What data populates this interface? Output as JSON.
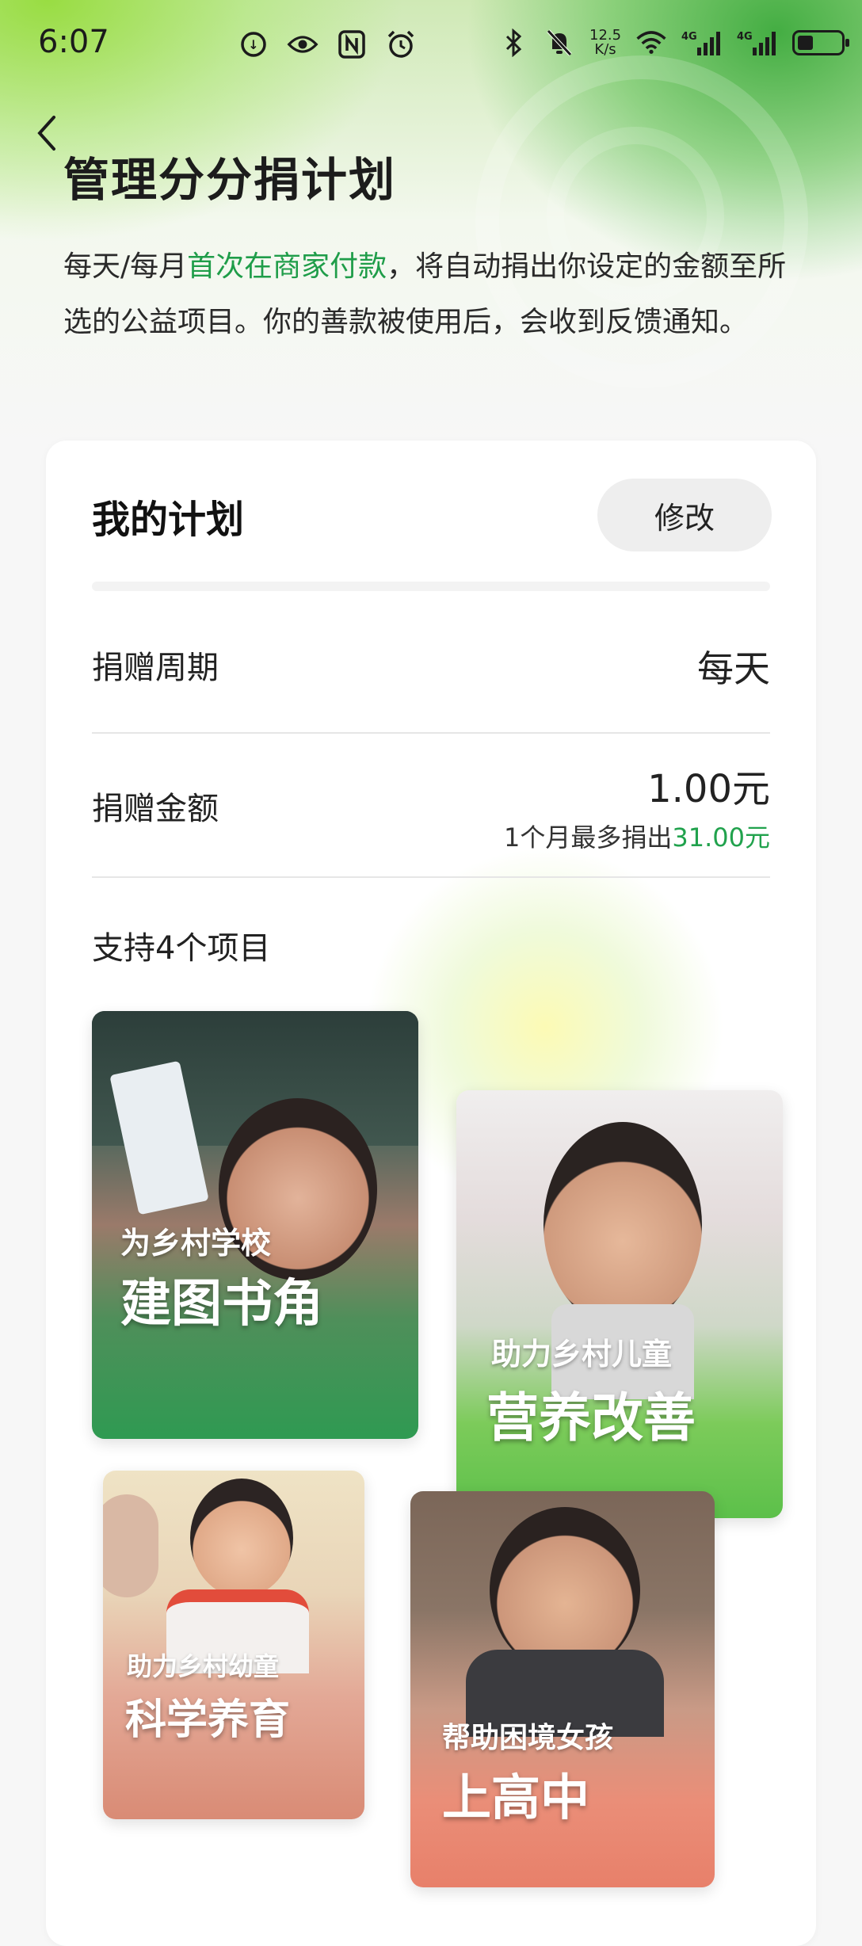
{
  "status_bar": {
    "time": "6:07",
    "net_speed_top": "12.5",
    "net_speed_bottom": "K/s",
    "battery_level": 0.35,
    "network_label_1": "4G",
    "network_label_2": "4G"
  },
  "header": {
    "title": "管理分分捐计划",
    "desc_before": "每天/每月",
    "desc_highlight": "首次在商家付款",
    "desc_after": "，将自动捐出你设定的金额至所选的公益项目。你的善款被使用后，会收到反馈通知。",
    "highlight_color": "#1f9d49"
  },
  "plan": {
    "title": "我的计划",
    "edit_label": "修改",
    "period_label": "捐赠周期",
    "period_value": "每天",
    "amount_label": "捐赠金额",
    "amount_value": "1.00元",
    "max_prefix": "1个月最多捐出",
    "max_value": "31.00元",
    "support_label": "支持4个项目"
  },
  "projects": [
    {
      "line1": "为乡村学校",
      "line2": "建图书角",
      "color": "#2f9a52"
    },
    {
      "line1": "助力乡村儿童",
      "line2": "营养改善",
      "color": "#5cc04a"
    },
    {
      "line1": "助力乡村幼童",
      "line2": "科学养育",
      "color": "#d98b75"
    },
    {
      "line1": "帮助困境女孩",
      "line2": "上高中",
      "color": "#e8806a"
    }
  ],
  "icons": {
    "back": "chevron-left-icon",
    "status": [
      "data-saver-icon",
      "eye-icon",
      "nfc-icon",
      "alarm-icon",
      "bluetooth-icon",
      "mute-icon",
      "wifi-icon",
      "signal-icon",
      "battery-icon"
    ]
  }
}
